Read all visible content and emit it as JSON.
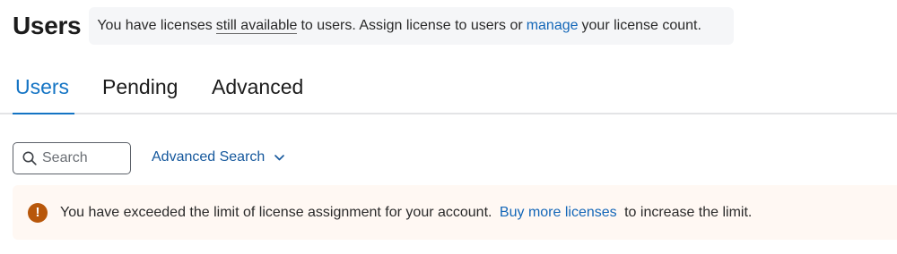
{
  "header": {
    "title": "Users",
    "notice": {
      "prefix": "You have licenses",
      "link_available": "still available",
      "middle": "to users. Assign license to users or",
      "link_manage": "manage",
      "suffix": "your license count."
    }
  },
  "tabs": [
    {
      "label": "Users",
      "active": true
    },
    {
      "label": "Pending",
      "active": false
    },
    {
      "label": "Advanced",
      "active": false
    }
  ],
  "search": {
    "placeholder": "Search",
    "value": "",
    "advanced_label": "Advanced Search"
  },
  "warning": {
    "icon": "exclamation-icon",
    "prefix": "You have exceeded the limit of license assignment for your account.",
    "link": "Buy more licenses",
    "suffix": "to increase the limit."
  },
  "colors": {
    "accent": "#1474c4",
    "link": "#1467b8",
    "warning_icon": "#b8570a",
    "warning_bg": "#fff8f3",
    "notice_bg": "#f5f6f8"
  }
}
